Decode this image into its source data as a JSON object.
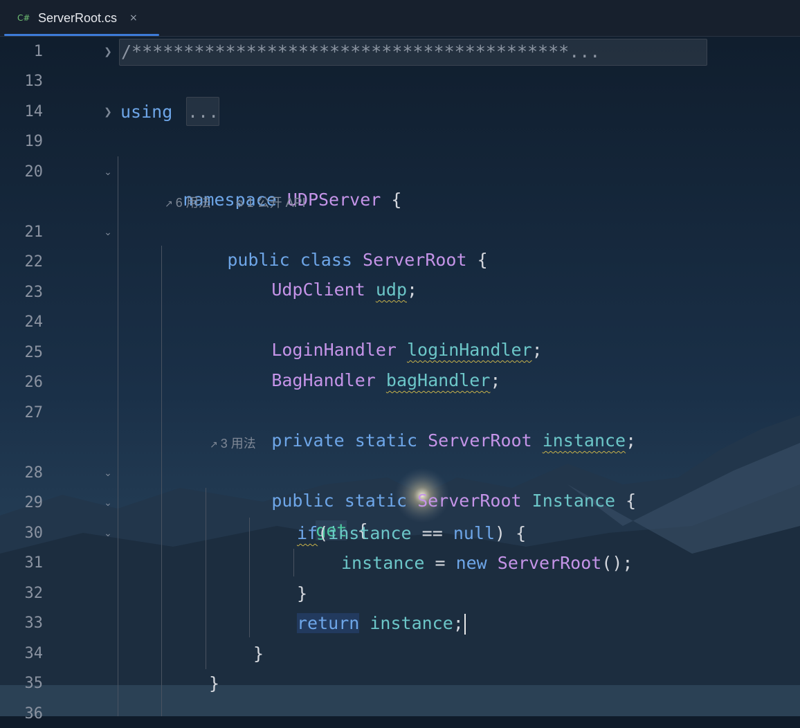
{
  "tab": {
    "icon_label": "C#",
    "title": "ServerRoot.cs",
    "close_glyph": "×"
  },
  "gutter_icons": {
    "collapsed": "chevron-right-icon",
    "expanded": "chevron-down-icon"
  },
  "lines": {
    "l1": {
      "num": "1",
      "comment": "/******************************************..."
    },
    "l13": {
      "num": "13"
    },
    "l14": {
      "num": "14",
      "kw": "using",
      "folded": "..."
    },
    "l19": {
      "num": "19"
    },
    "l20": {
      "num": "20",
      "kw": "namespace",
      "name": "UDPServer",
      "brace": "{"
    },
    "hint1": {
      "usages": "6 用法",
      "api": "1 公开 API"
    },
    "l21": {
      "num": "21",
      "kw1": "public",
      "kw2": "class",
      "name": "ServerRoot",
      "brace": "{"
    },
    "l22": {
      "num": "22",
      "type": "UdpClient",
      "field": "udp",
      "semi": ";"
    },
    "l23": {
      "num": "23"
    },
    "l24": {
      "num": "24",
      "type": "LoginHandler",
      "field": "loginHandler",
      "semi": ";"
    },
    "l25": {
      "num": "25",
      "type": "BagHandler",
      "field": "bagHandler",
      "semi": ";"
    },
    "l26": {
      "num": "26"
    },
    "l27": {
      "num": "27",
      "kw1": "private",
      "kw2": "static",
      "type": "ServerRoot",
      "field": "instance",
      "semi": ";"
    },
    "hint2": {
      "usages": "3 用法"
    },
    "l28": {
      "num": "28",
      "kw1": "public",
      "kw2": "static",
      "type": "ServerRoot",
      "prop": "Instance",
      "brace": "{"
    },
    "l29": {
      "num": "29",
      "acc": "get",
      "brace": "{"
    },
    "l30": {
      "num": "30",
      "kw": "if",
      "open": "(",
      "var": "instance",
      "op": " == ",
      "null": "null",
      "close": ") {"
    },
    "l31": {
      "num": "31",
      "var": "instance",
      "op": " = ",
      "kw": "new",
      "type": "ServerRoot",
      "tail": "();"
    },
    "l32": {
      "num": "32",
      "brace": "}"
    },
    "l33": {
      "num": "33",
      "kw": "return",
      "var": "instance",
      "semi": ";"
    },
    "l34": {
      "num": "34",
      "brace": "}"
    },
    "l35": {
      "num": "35",
      "brace": "}"
    },
    "l36": {
      "num": "36"
    }
  }
}
